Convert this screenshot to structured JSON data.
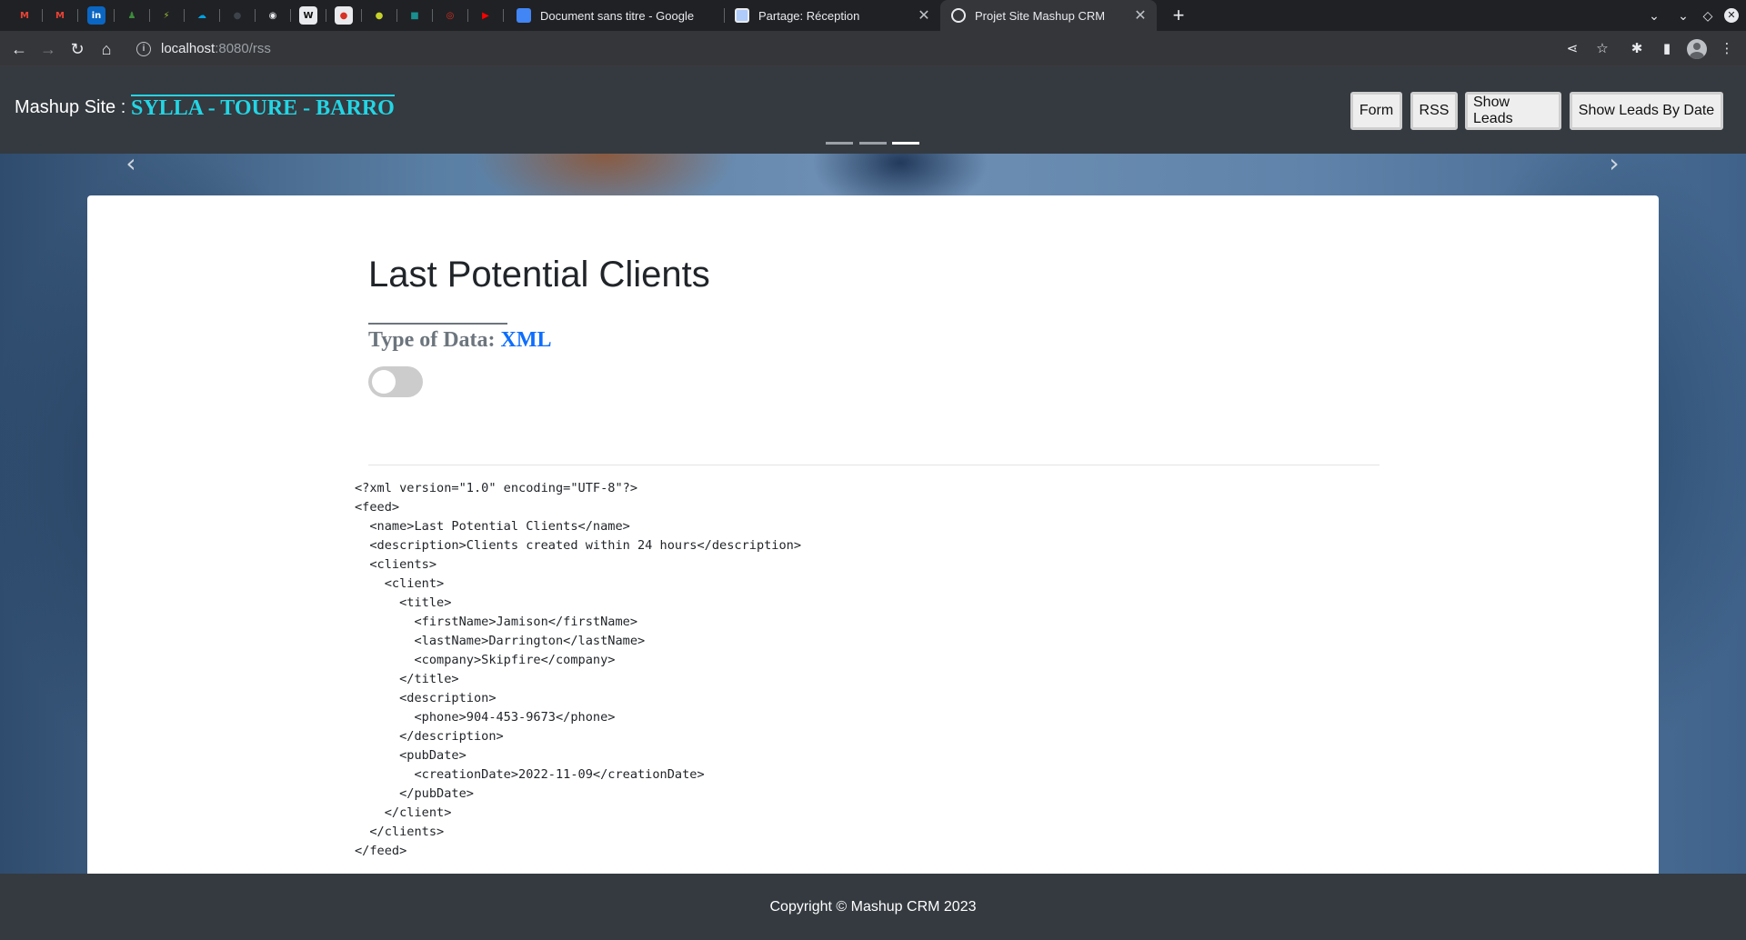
{
  "browser": {
    "pinned_tabs": [
      {
        "icon": "gmail-icon",
        "glyph": "M",
        "color": "#ea4335"
      },
      {
        "icon": "gmail-icon",
        "glyph": "M",
        "color": "#ea4335"
      },
      {
        "icon": "linkedin-icon",
        "glyph": "in",
        "color": "#0a66c2"
      },
      {
        "icon": "app-icon",
        "glyph": "♟",
        "color": "#3c8c3c"
      },
      {
        "icon": "app-icon",
        "glyph": "⚡",
        "color": "#6a8f2a"
      },
      {
        "icon": "salesforce-icon",
        "glyph": "☁",
        "color": "#00a1e0"
      },
      {
        "icon": "github-icon",
        "glyph": "●",
        "color": "#30363d"
      },
      {
        "icon": "globe-icon",
        "glyph": "◉",
        "color": "#e8eaed"
      },
      {
        "icon": "app-icon",
        "glyph": "W",
        "color": "#111111"
      },
      {
        "icon": "app-icon",
        "glyph": "●",
        "color": "#d93025"
      },
      {
        "icon": "app-icon",
        "glyph": "●",
        "color": "#c6d22a"
      },
      {
        "icon": "app-icon",
        "glyph": "■",
        "color": "#1a8f8f"
      },
      {
        "icon": "app-icon",
        "glyph": "◎",
        "color": "#d93025"
      },
      {
        "icon": "youtube-icon",
        "glyph": "▶",
        "color": "#ff0000"
      }
    ],
    "tabs": [
      {
        "title": "Document sans titre - Google",
        "icon": "google-docs-icon",
        "active": false
      },
      {
        "title": "Partage: Réception",
        "icon": "page-icon",
        "active": false
      },
      {
        "title": "Projet Site Mashup CRM",
        "icon": "globe-icon",
        "active": true
      }
    ],
    "address": {
      "host": "localhost",
      "path": ":8080/rss"
    }
  },
  "header": {
    "brand_label": "Mashup Site :",
    "brand_names": "SYLLA - TOURE - BARRO",
    "nav": [
      {
        "label": "Form"
      },
      {
        "label": "RSS"
      },
      {
        "label": "Show Leads"
      },
      {
        "label": "Show Leads By Date"
      }
    ],
    "carousel_active_index": 3,
    "carousel_count": 3
  },
  "main": {
    "title": "Last Potential Clients",
    "type_label": "Type of Data:",
    "type_value": "XML",
    "toggle_on": false,
    "code": "<?xml version=\"1.0\" encoding=\"UTF-8\"?>\n<feed>\n  <name>Last Potential Clients</name>\n  <description>Clients created within 24 hours</description>\n  <clients>\n    <client>\n      <title>\n        <firstName>Jamison</firstName>\n        <lastName>Darrington</lastName>\n        <company>Skipfire</company>\n      </title>\n      <description>\n        <phone>904-453-9673</phone>\n      </description>\n      <pubDate>\n        <creationDate>2022-11-09</creationDate>\n      </pubDate>\n    </client>\n  </clients>\n</feed>"
  },
  "footer": {
    "text": "Copyright © Mashup CRM 2023"
  }
}
